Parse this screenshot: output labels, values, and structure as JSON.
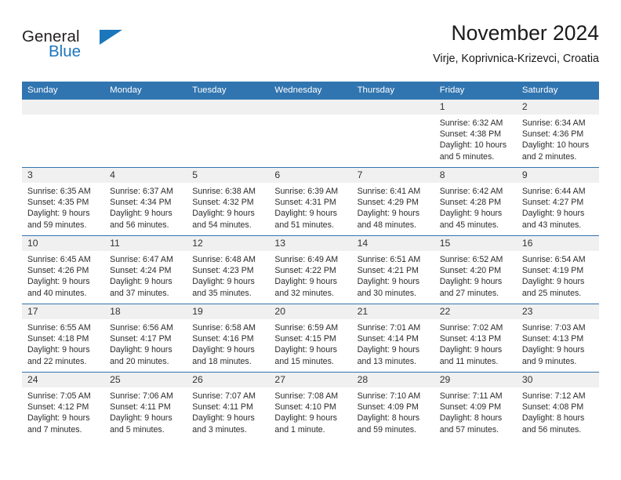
{
  "brand": {
    "name_part1": "General",
    "name_part2": "Blue",
    "triangle_color": "#1b76bc"
  },
  "header": {
    "title": "November 2024",
    "subtitle": "Virje, Koprivnica-Krizevci, Croatia",
    "accent_color": "#3175b0",
    "daynum_band_color": "#f0f0f0"
  },
  "weekdays": [
    "Sunday",
    "Monday",
    "Tuesday",
    "Wednesday",
    "Thursday",
    "Friday",
    "Saturday"
  ],
  "weeks": [
    [
      {
        "day": "",
        "empty": true,
        "sunrise": "",
        "sunset": "",
        "daylight1": "",
        "daylight2": ""
      },
      {
        "day": "",
        "empty": true,
        "sunrise": "",
        "sunset": "",
        "daylight1": "",
        "daylight2": ""
      },
      {
        "day": "",
        "empty": true,
        "sunrise": "",
        "sunset": "",
        "daylight1": "",
        "daylight2": ""
      },
      {
        "day": "",
        "empty": true,
        "sunrise": "",
        "sunset": "",
        "daylight1": "",
        "daylight2": ""
      },
      {
        "day": "",
        "empty": true,
        "sunrise": "",
        "sunset": "",
        "daylight1": "",
        "daylight2": ""
      },
      {
        "day": "1",
        "sunrise": "Sunrise: 6:32 AM",
        "sunset": "Sunset: 4:38 PM",
        "daylight1": "Daylight: 10 hours",
        "daylight2": "and 5 minutes."
      },
      {
        "day": "2",
        "sunrise": "Sunrise: 6:34 AM",
        "sunset": "Sunset: 4:36 PM",
        "daylight1": "Daylight: 10 hours",
        "daylight2": "and 2 minutes."
      }
    ],
    [
      {
        "day": "3",
        "sunrise": "Sunrise: 6:35 AM",
        "sunset": "Sunset: 4:35 PM",
        "daylight1": "Daylight: 9 hours",
        "daylight2": "and 59 minutes."
      },
      {
        "day": "4",
        "sunrise": "Sunrise: 6:37 AM",
        "sunset": "Sunset: 4:34 PM",
        "daylight1": "Daylight: 9 hours",
        "daylight2": "and 56 minutes."
      },
      {
        "day": "5",
        "sunrise": "Sunrise: 6:38 AM",
        "sunset": "Sunset: 4:32 PM",
        "daylight1": "Daylight: 9 hours",
        "daylight2": "and 54 minutes."
      },
      {
        "day": "6",
        "sunrise": "Sunrise: 6:39 AM",
        "sunset": "Sunset: 4:31 PM",
        "daylight1": "Daylight: 9 hours",
        "daylight2": "and 51 minutes."
      },
      {
        "day": "7",
        "sunrise": "Sunrise: 6:41 AM",
        "sunset": "Sunset: 4:29 PM",
        "daylight1": "Daylight: 9 hours",
        "daylight2": "and 48 minutes."
      },
      {
        "day": "8",
        "sunrise": "Sunrise: 6:42 AM",
        "sunset": "Sunset: 4:28 PM",
        "daylight1": "Daylight: 9 hours",
        "daylight2": "and 45 minutes."
      },
      {
        "day": "9",
        "sunrise": "Sunrise: 6:44 AM",
        "sunset": "Sunset: 4:27 PM",
        "daylight1": "Daylight: 9 hours",
        "daylight2": "and 43 minutes."
      }
    ],
    [
      {
        "day": "10",
        "sunrise": "Sunrise: 6:45 AM",
        "sunset": "Sunset: 4:26 PM",
        "daylight1": "Daylight: 9 hours",
        "daylight2": "and 40 minutes."
      },
      {
        "day": "11",
        "sunrise": "Sunrise: 6:47 AM",
        "sunset": "Sunset: 4:24 PM",
        "daylight1": "Daylight: 9 hours",
        "daylight2": "and 37 minutes."
      },
      {
        "day": "12",
        "sunrise": "Sunrise: 6:48 AM",
        "sunset": "Sunset: 4:23 PM",
        "daylight1": "Daylight: 9 hours",
        "daylight2": "and 35 minutes."
      },
      {
        "day": "13",
        "sunrise": "Sunrise: 6:49 AM",
        "sunset": "Sunset: 4:22 PM",
        "daylight1": "Daylight: 9 hours",
        "daylight2": "and 32 minutes."
      },
      {
        "day": "14",
        "sunrise": "Sunrise: 6:51 AM",
        "sunset": "Sunset: 4:21 PM",
        "daylight1": "Daylight: 9 hours",
        "daylight2": "and 30 minutes."
      },
      {
        "day": "15",
        "sunrise": "Sunrise: 6:52 AM",
        "sunset": "Sunset: 4:20 PM",
        "daylight1": "Daylight: 9 hours",
        "daylight2": "and 27 minutes."
      },
      {
        "day": "16",
        "sunrise": "Sunrise: 6:54 AM",
        "sunset": "Sunset: 4:19 PM",
        "daylight1": "Daylight: 9 hours",
        "daylight2": "and 25 minutes."
      }
    ],
    [
      {
        "day": "17",
        "sunrise": "Sunrise: 6:55 AM",
        "sunset": "Sunset: 4:18 PM",
        "daylight1": "Daylight: 9 hours",
        "daylight2": "and 22 minutes."
      },
      {
        "day": "18",
        "sunrise": "Sunrise: 6:56 AM",
        "sunset": "Sunset: 4:17 PM",
        "daylight1": "Daylight: 9 hours",
        "daylight2": "and 20 minutes."
      },
      {
        "day": "19",
        "sunrise": "Sunrise: 6:58 AM",
        "sunset": "Sunset: 4:16 PM",
        "daylight1": "Daylight: 9 hours",
        "daylight2": "and 18 minutes."
      },
      {
        "day": "20",
        "sunrise": "Sunrise: 6:59 AM",
        "sunset": "Sunset: 4:15 PM",
        "daylight1": "Daylight: 9 hours",
        "daylight2": "and 15 minutes."
      },
      {
        "day": "21",
        "sunrise": "Sunrise: 7:01 AM",
        "sunset": "Sunset: 4:14 PM",
        "daylight1": "Daylight: 9 hours",
        "daylight2": "and 13 minutes."
      },
      {
        "day": "22",
        "sunrise": "Sunrise: 7:02 AM",
        "sunset": "Sunset: 4:13 PM",
        "daylight1": "Daylight: 9 hours",
        "daylight2": "and 11 minutes."
      },
      {
        "day": "23",
        "sunrise": "Sunrise: 7:03 AM",
        "sunset": "Sunset: 4:13 PM",
        "daylight1": "Daylight: 9 hours",
        "daylight2": "and 9 minutes."
      }
    ],
    [
      {
        "day": "24",
        "sunrise": "Sunrise: 7:05 AM",
        "sunset": "Sunset: 4:12 PM",
        "daylight1": "Daylight: 9 hours",
        "daylight2": "and 7 minutes."
      },
      {
        "day": "25",
        "sunrise": "Sunrise: 7:06 AM",
        "sunset": "Sunset: 4:11 PM",
        "daylight1": "Daylight: 9 hours",
        "daylight2": "and 5 minutes."
      },
      {
        "day": "26",
        "sunrise": "Sunrise: 7:07 AM",
        "sunset": "Sunset: 4:11 PM",
        "daylight1": "Daylight: 9 hours",
        "daylight2": "and 3 minutes."
      },
      {
        "day": "27",
        "sunrise": "Sunrise: 7:08 AM",
        "sunset": "Sunset: 4:10 PM",
        "daylight1": "Daylight: 9 hours",
        "daylight2": "and 1 minute."
      },
      {
        "day": "28",
        "sunrise": "Sunrise: 7:10 AM",
        "sunset": "Sunset: 4:09 PM",
        "daylight1": "Daylight: 8 hours",
        "daylight2": "and 59 minutes."
      },
      {
        "day": "29",
        "sunrise": "Sunrise: 7:11 AM",
        "sunset": "Sunset: 4:09 PM",
        "daylight1": "Daylight: 8 hours",
        "daylight2": "and 57 minutes."
      },
      {
        "day": "30",
        "sunrise": "Sunrise: 7:12 AM",
        "sunset": "Sunset: 4:08 PM",
        "daylight1": "Daylight: 8 hours",
        "daylight2": "and 56 minutes."
      }
    ]
  ]
}
